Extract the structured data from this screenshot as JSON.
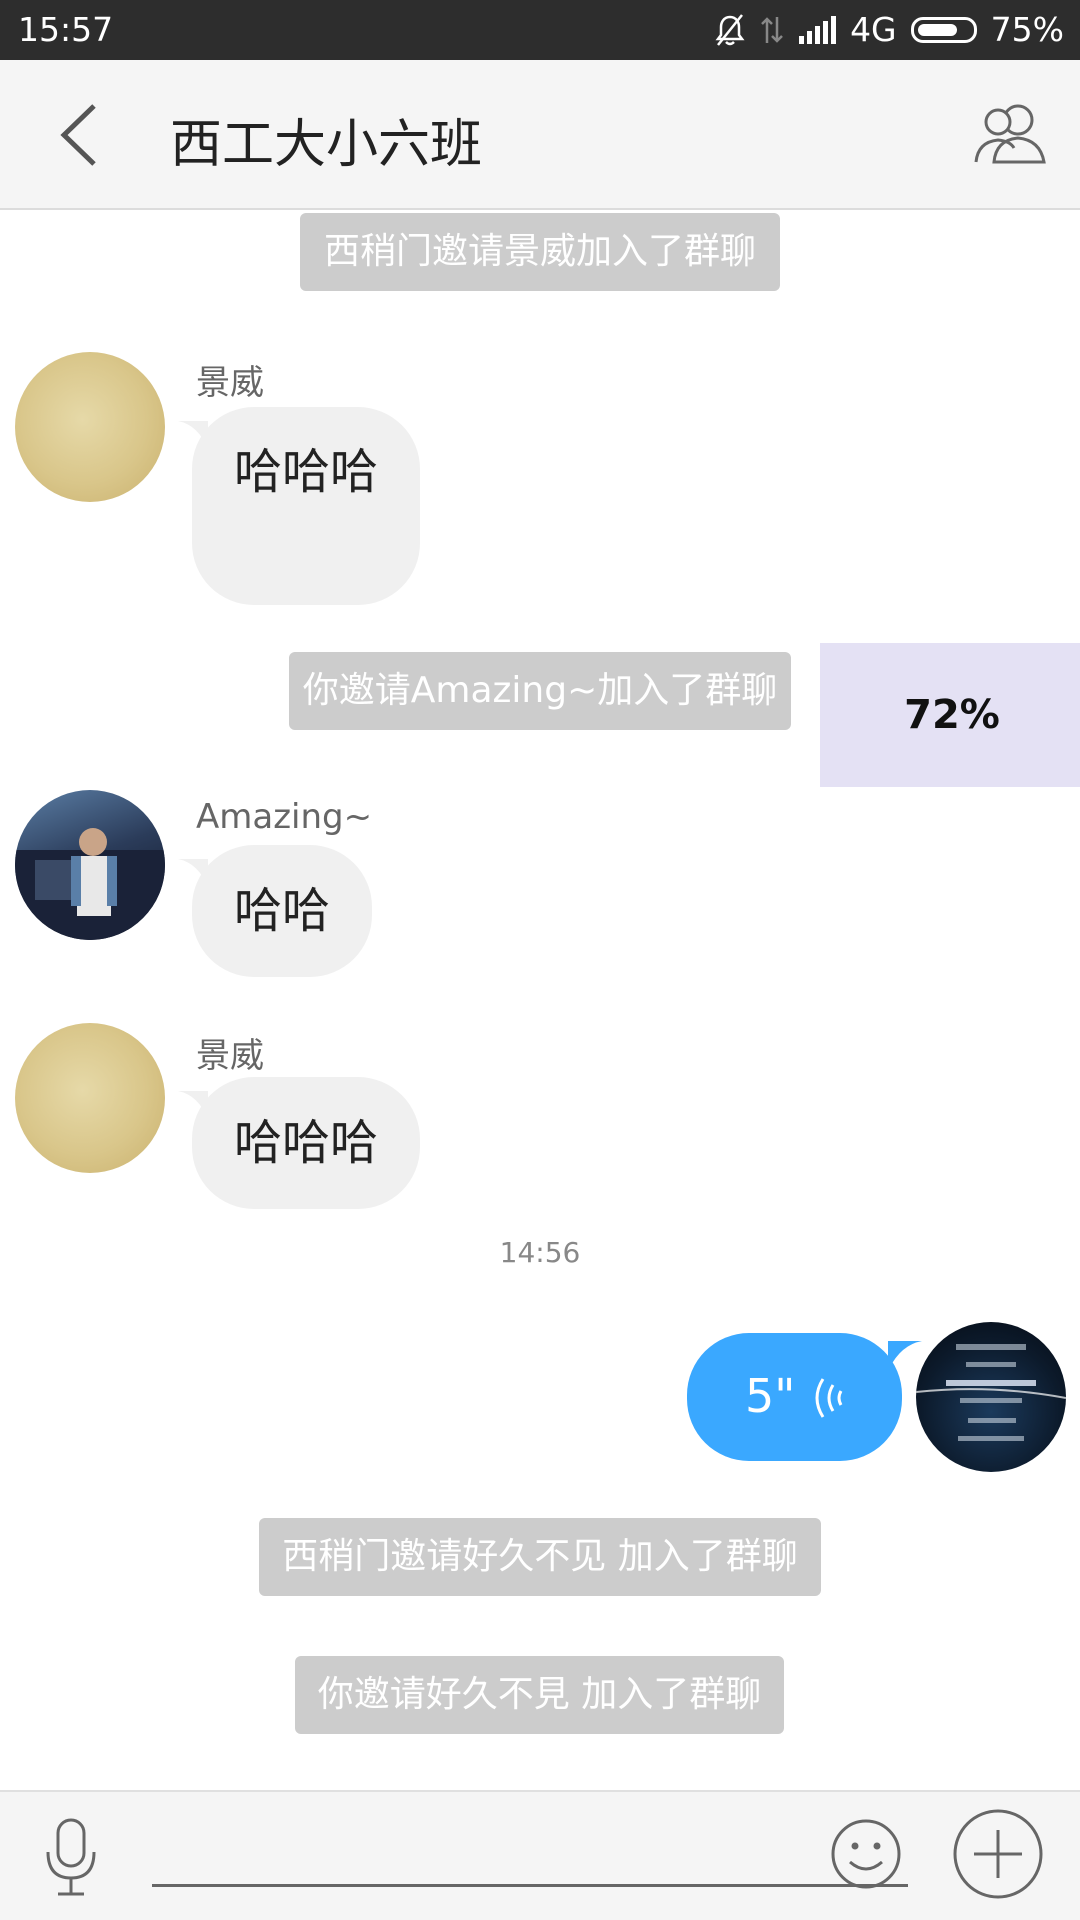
{
  "status_bar": {
    "time": "15:57",
    "network": "4G",
    "battery": "75%",
    "battery_level": 0.75
  },
  "header": {
    "title": "西工大小六班",
    "back_icon": "chevron-left-icon",
    "members_icon": "group-members-icon"
  },
  "messages": {
    "sys1": "西稍门邀请景威加入了群聊",
    "msg1": {
      "sender": "景威",
      "text": "哈哈哈"
    },
    "sys2": "你邀请Amazing~加入了群聊",
    "msg2": {
      "sender": "Amazing~",
      "text": "哈哈"
    },
    "msg3": {
      "sender": "景威",
      "text": "哈哈哈"
    },
    "timestamp": "14:56",
    "voice": {
      "duration": "5\""
    },
    "sys3": "西稍门邀请好久不见 加入了群聊",
    "sys4": "你邀请好久不見 加入了群聊"
  },
  "overlay": {
    "progress_text": "72%"
  },
  "input_bar": {
    "placeholder": "",
    "mic_icon": "microphone-icon",
    "emoji_icon": "smiley-icon",
    "plus_icon": "plus-circle-icon"
  },
  "colors": {
    "voice_bubble": "#3aa8ff",
    "system_pill": "#cccccc",
    "incoming_bubble": "#f0f0f0",
    "header_bg": "#f5f5f5"
  }
}
